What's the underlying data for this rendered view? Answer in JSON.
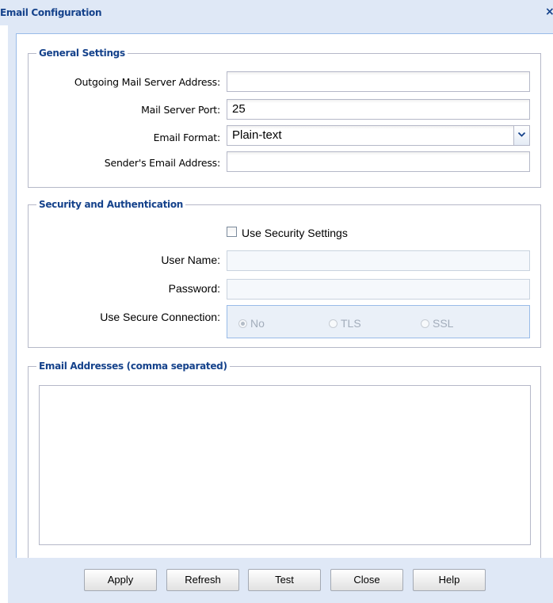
{
  "dialog": {
    "title": "Email Configuration",
    "close_icon": "close-icon"
  },
  "general": {
    "legend": "General Settings",
    "outgoing_server_label": "Outgoing Mail Server Address:",
    "outgoing_server_value": "",
    "port_label": "Mail Server Port:",
    "port_value": "25",
    "format_label": "Email Format:",
    "format_value": "Plain-text",
    "sender_label": "Sender's Email Address:",
    "sender_value": ""
  },
  "security": {
    "legend": "Security and Authentication",
    "use_security_label": "Use Security Settings",
    "use_security_checked": false,
    "username_label": "User Name:",
    "username_value": "",
    "password_label": "Password:",
    "password_value": "",
    "secure_connection_label": "Use Secure Connection:",
    "options": [
      "No",
      "TLS",
      "SSL"
    ],
    "selected_option": "No"
  },
  "emails": {
    "legend": "Email Addresses (comma separated)",
    "value": ""
  },
  "buttons": {
    "apply": "Apply",
    "refresh": "Refresh",
    "test": "Test",
    "close": "Close",
    "help": "Help"
  },
  "colors": {
    "title_text": "#15428b",
    "dialog_background": "#dfe8f6",
    "border_accent": "#99bbe8"
  }
}
